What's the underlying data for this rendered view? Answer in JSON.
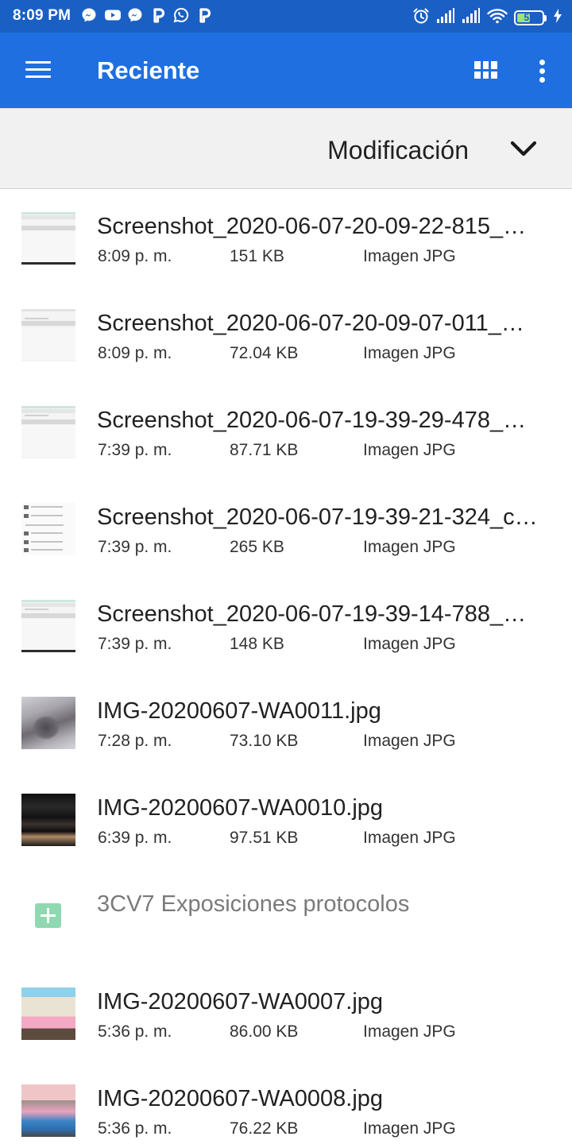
{
  "status_bar": {
    "time": "8:09 PM",
    "notification_icons": [
      "messenger-icon",
      "youtube-icon",
      "messenger-icon",
      "p-app-icon",
      "whatsapp-icon",
      "p-app-icon"
    ],
    "battery_level": "51"
  },
  "app_bar": {
    "title": "Reciente"
  },
  "sort_bar": {
    "label": "Modificación"
  },
  "files": [
    {
      "name": "Screenshot_2020-06-07-20-09-22-815_…",
      "time": "8:09 p. m.",
      "size": "151 KB",
      "type": "Imagen JPG",
      "thumb": "screenshot"
    },
    {
      "name": "Screenshot_2020-06-07-20-09-07-011_…",
      "time": "8:09 p. m.",
      "size": "72.04 KB",
      "type": "Imagen JPG",
      "thumb": "screenshot-plain"
    },
    {
      "name": "Screenshot_2020-06-07-19-39-29-478_…",
      "time": "7:39 p. m.",
      "size": "87.71 KB",
      "type": "Imagen JPG",
      "thumb": "screenshot-plain"
    },
    {
      "name": "Screenshot_2020-06-07-19-39-21-324_c…",
      "time": "7:39 p. m.",
      "size": "265 KB",
      "type": "Imagen JPG",
      "thumb": "list"
    },
    {
      "name": "Screenshot_2020-06-07-19-39-14-788_…",
      "time": "7:39 p. m.",
      "size": "148 KB",
      "type": "Imagen JPG",
      "thumb": "screenshot"
    },
    {
      "name": "IMG-20200607-WA0011.jpg",
      "time": "7:28 p. m.",
      "size": "73.10 KB",
      "type": "Imagen JPG",
      "thumb": "cat-photo"
    },
    {
      "name": "IMG-20200607-WA0010.jpg",
      "time": "6:39 p. m.",
      "size": "97.51 KB",
      "type": "Imagen JPG",
      "thumb": "bags-photo"
    }
  ],
  "folder": {
    "name": "3CV7 Exposiciones protocolos",
    "icon": "add-folder-icon"
  },
  "files_after_folder": [
    {
      "name": "IMG-20200607-WA0007.jpg",
      "time": "5:36 p. m.",
      "size": "86.00 KB",
      "type": "Imagen JPG",
      "thumb": "comic-photo"
    },
    {
      "name": "IMG-20200607-WA0008.jpg",
      "time": "5:36 p. m.",
      "size": "76.22 KB",
      "type": "Imagen JPG",
      "thumb": "comic-photo-2"
    }
  ]
}
